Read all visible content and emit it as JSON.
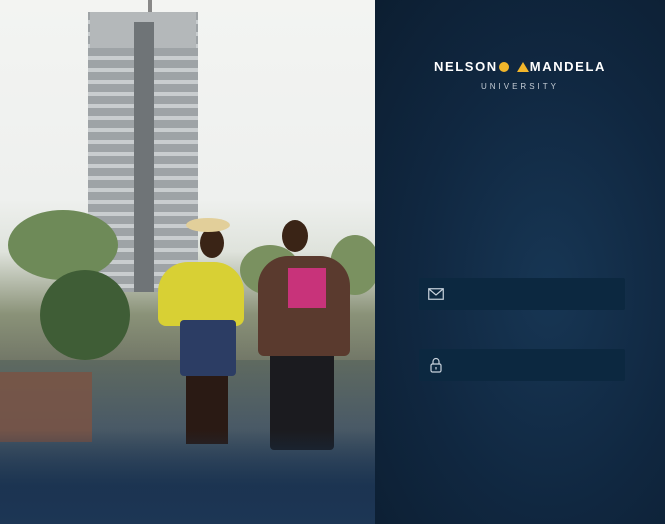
{
  "brand": {
    "name_part1": "NELSON",
    "name_part2": "MANDELA",
    "subtitle": "UNIVERSITY",
    "accent_color": "#f2b62b"
  },
  "login_form": {
    "email": {
      "icon": "mail-icon",
      "value": "",
      "placeholder": ""
    },
    "password": {
      "icon": "lock-icon",
      "value": "",
      "placeholder": ""
    }
  },
  "colors": {
    "panel_bg": "#102740",
    "field_bg": "#0c2840"
  }
}
